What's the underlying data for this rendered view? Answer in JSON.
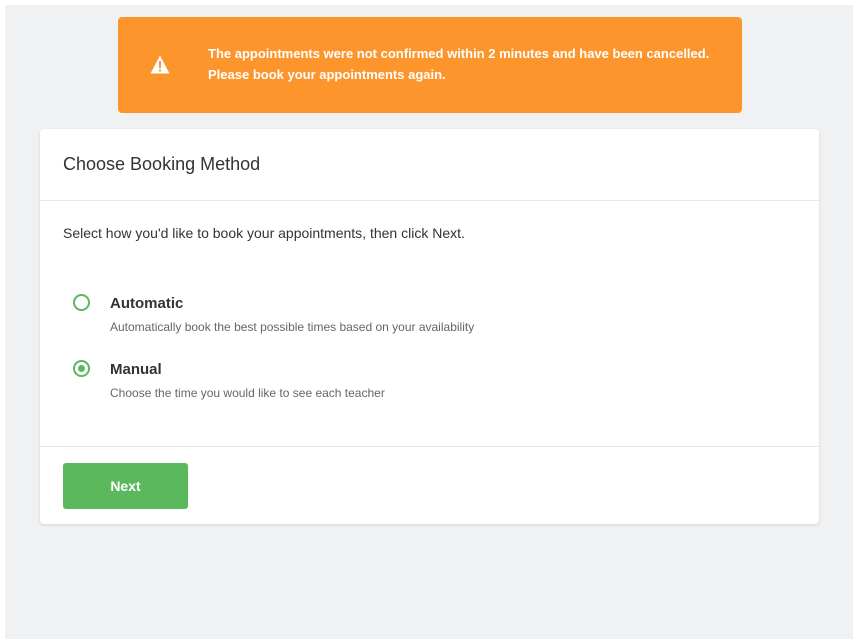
{
  "alert": {
    "icon": "warning-icon",
    "message": "The appointments were not confirmed within 2 minutes and have been cancelled. Please book your appointments again.",
    "color": "#fd952d"
  },
  "card": {
    "title": "Choose Booking Method",
    "instructions": "Select how you'd like to book your appointments, then click Next.",
    "options": [
      {
        "label": "Automatic",
        "description": "Automatically book the best possible times based on your availability",
        "selected": false
      },
      {
        "label": "Manual",
        "description": "Choose the time you would like to see each teacher",
        "selected": true
      }
    ],
    "next_label": "Next",
    "accent_color": "#5cb85c"
  }
}
